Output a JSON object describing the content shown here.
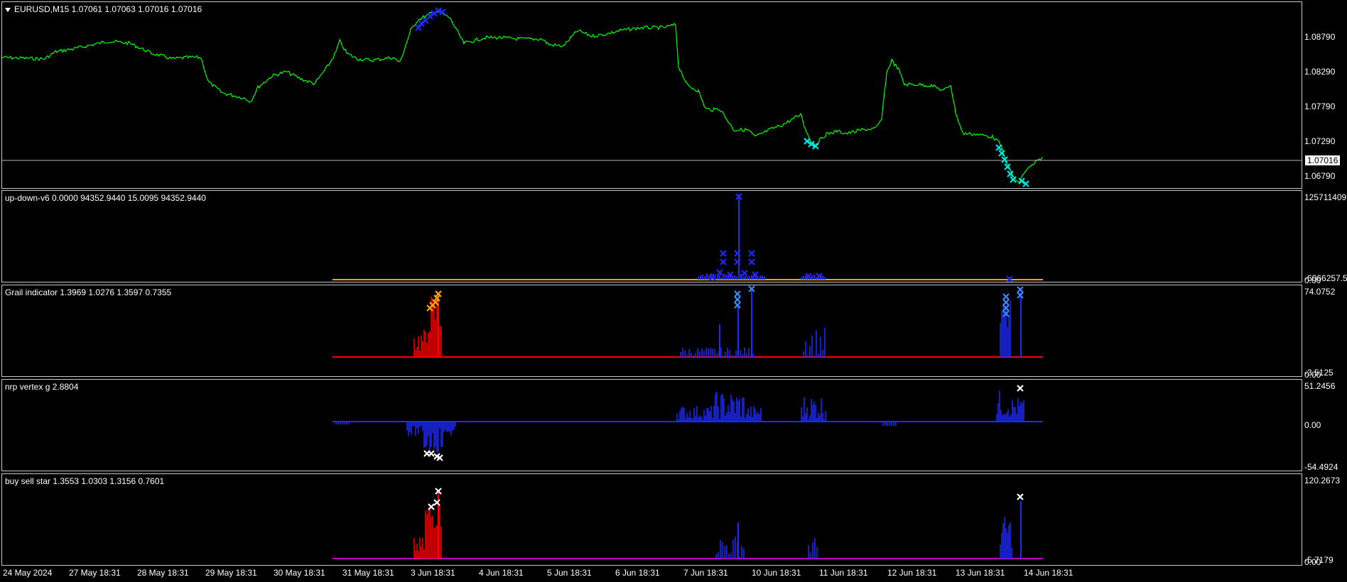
{
  "main": {
    "title": "EURUSD,M15  1.07061 1.07063 1.07016 1.07016",
    "ticks": [
      "1.08790",
      "1.08290",
      "1.07790",
      "1.07290",
      "1.06790"
    ],
    "current_price": "1.07016",
    "colors": {
      "line": "#00ff00",
      "buy_marker": "#00e5e5",
      "sell_marker": "#1e2aff",
      "hline": "#b0b0b0"
    }
  },
  "panes": [
    {
      "id": "up-down",
      "title": "up-down-v6 0.0000 94352.9440 15.0095 94352.9440",
      "ticks": [
        "125711409",
        "-6066257.5",
        "0.00"
      ]
    },
    {
      "id": "grail",
      "title": "Grail indicator 1.3969 1.0276 1.3597 0.7355",
      "ticks": [
        "74.0752",
        "-3.5125",
        "0.00"
      ]
    },
    {
      "id": "nrp",
      "title": "nrp vertex g 2.8804",
      "ticks": [
        "51.2456",
        "0.00",
        "-54.4924"
      ]
    },
    {
      "id": "buysell",
      "title": "buy sell star 1.3553 1.0303 1.3156 0.7601",
      "ticks": [
        "120.2673",
        "-5.7179",
        "0.00"
      ]
    }
  ],
  "time_axis": [
    "24 May 2024",
    "27 May 18:31",
    "28 May 18:31",
    "29 May 18:31",
    "30 May 18:31",
    "31 May 18:31",
    "3 Jun 18:31",
    "4 Jun 18:31",
    "5 Jun 18:31",
    "6 Jun 18:31",
    "7 Jun 18:31",
    "10 Jun 18:31",
    "11 Jun 18:31",
    "12 Jun 18:31",
    "13 Jun 18:31",
    "14 Jun 18:31"
  ]
}
